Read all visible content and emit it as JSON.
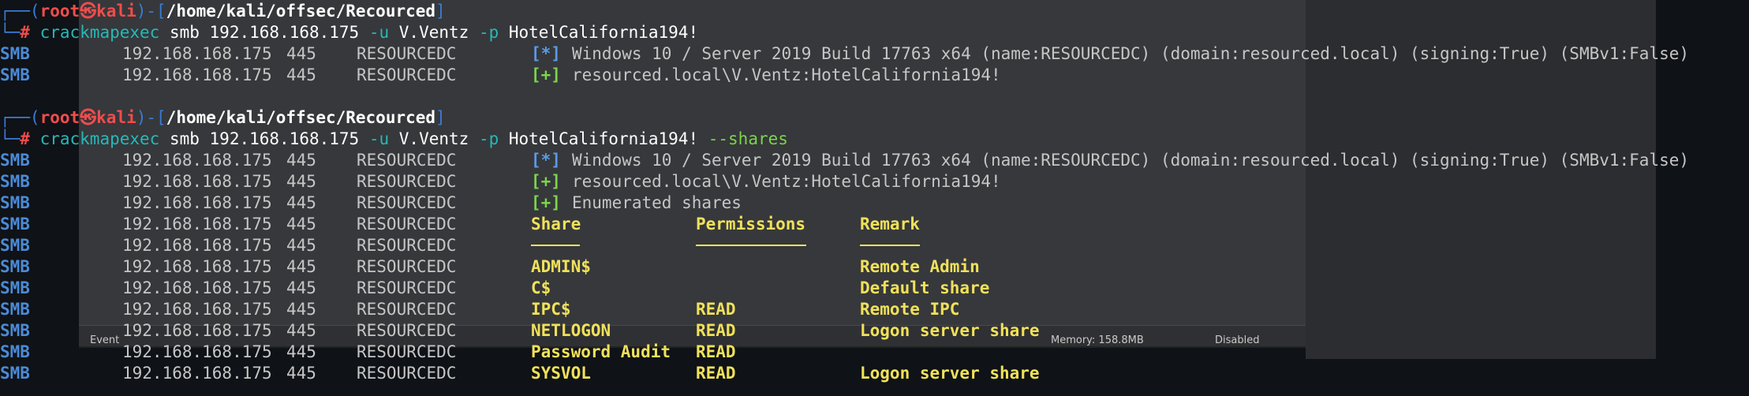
{
  "status_bar": {
    "event_text": "Event",
    "memory_text": "Memory: 158.8MB",
    "disabled_text": "Disabled"
  },
  "prompt": {
    "box_top": "┌──(",
    "user": "root",
    "at_symbol": "㉿",
    "host": "kali",
    "close_bracket": ")-[",
    "path": "/home/kali/offsec/Recourced",
    "end_bracket": "]",
    "box_bottom": "└─",
    "hash": "#"
  },
  "commands": [
    {
      "tool": "crackmapexec",
      "parts": [
        " smb 192.168.168.175 ",
        "-u",
        " V.Ventz ",
        "-p",
        " HotelCalifornia194!",
        ""
      ],
      "flag_extra": ""
    },
    {
      "tool": "crackmapexec",
      "parts": [
        " smb 192.168.168.175 ",
        "-u",
        " V.Ventz ",
        "-p",
        " HotelCalifornia194! ",
        "--shares"
      ],
      "flag_extra": "--shares"
    }
  ],
  "output_block_1": [
    {
      "proto": "SMB",
      "ip": "192.168.168.175",
      "port": "445",
      "host": "RESOURCEDC",
      "marker": "[*]",
      "marker_type": "star",
      "text": "Windows 10 / Server 2019 Build 17763 x64 (name:RESOURCEDC) (domain:resourced.local) (signing:True) (SMBv1:False)"
    },
    {
      "proto": "SMB",
      "ip": "192.168.168.175",
      "port": "445",
      "host": "RESOURCEDC",
      "marker": "[+]",
      "marker_type": "plus",
      "text": "resourced.local\\V.Ventz:HotelCalifornia194!"
    }
  ],
  "output_block_2_head": [
    {
      "proto": "SMB",
      "ip": "192.168.168.175",
      "port": "445",
      "host": "RESOURCEDC",
      "marker": "[*]",
      "marker_type": "star",
      "text": "Windows 10 / Server 2019 Build 17763 x64 (name:RESOURCEDC) (domain:resourced.local) (signing:True) (SMBv1:False)"
    },
    {
      "proto": "SMB",
      "ip": "192.168.168.175",
      "port": "445",
      "host": "RESOURCEDC",
      "marker": "[+]",
      "marker_type": "plus",
      "text": "resourced.local\\V.Ventz:HotelCalifornia194!"
    },
    {
      "proto": "SMB",
      "ip": "192.168.168.175",
      "port": "445",
      "host": "RESOURCEDC",
      "marker": "[+]",
      "marker_type": "plus",
      "text": "Enumerated shares"
    }
  ],
  "shares_table": {
    "columns": [
      "Share",
      "Permissions",
      "Remark"
    ],
    "underlines": [
      "-----",
      "-----------",
      "------"
    ],
    "row_prefix": {
      "proto": "SMB",
      "ip": "192.168.168.175",
      "port": "445",
      "host": "RESOURCEDC"
    },
    "rows": [
      {
        "share": "ADMIN$",
        "perm": "",
        "remark": "Remote Admin"
      },
      {
        "share": "C$",
        "perm": "",
        "remark": "Default share"
      },
      {
        "share": "IPC$",
        "perm": "READ",
        "remark": "Remote IPC"
      },
      {
        "share": "NETLOGON",
        "perm": "READ",
        "remark": "Logon server share"
      },
      {
        "share": "Password Audit",
        "perm": "READ",
        "remark": ""
      },
      {
        "share": "SYSVOL",
        "perm": "READ",
        "remark": "Logon server share"
      }
    ]
  },
  "colors": {
    "terminal_bg": "#0f1216",
    "prompt_box": "#3a7bd5",
    "prompt_user": "#f14c4c",
    "command": "#25b9b9",
    "flag": "#7bd44b",
    "smb_label": "#4b8ad6",
    "table_text": "#f0e15a"
  }
}
